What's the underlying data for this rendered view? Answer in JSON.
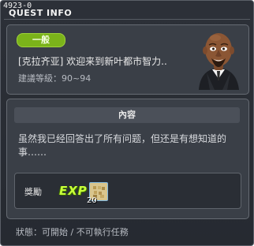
{
  "window": {
    "quest_id": "4923-0",
    "title": "QUEST INFO"
  },
  "quest": {
    "category_badge": "一般",
    "name": "[克拉齐亚] 欢迎来到新叶都市智力..",
    "level_requirement": "建議等級：90~94"
  },
  "content": {
    "header": "內容",
    "description": "虽然我已经回答出了所有问题，但还是有想知道的事……"
  },
  "reward": {
    "label": "獎勵",
    "exp_text": "EXP",
    "item_quantity": "20"
  },
  "status_text": "狀態：可開始 / 不可執行任務",
  "colors": {
    "badge_green": "#7bb31a",
    "exp_green": "#c8ff3a",
    "panel_bg": "#3a3f47",
    "window_bg": "#2c3038"
  }
}
